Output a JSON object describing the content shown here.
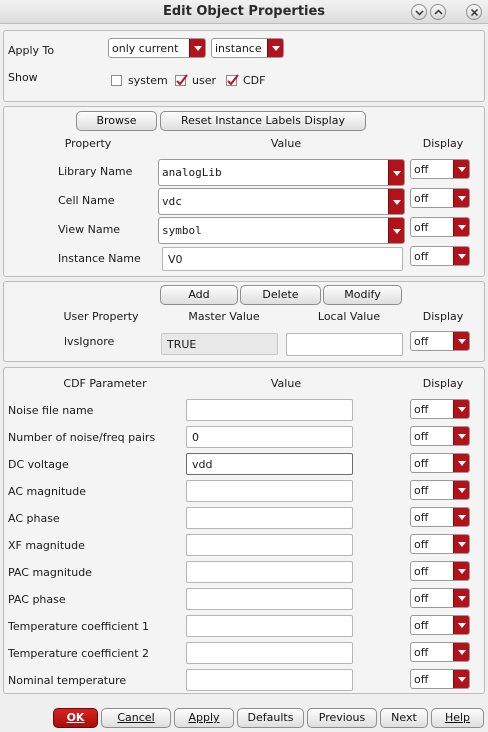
{
  "window": {
    "title": "Edit Object Properties"
  },
  "apply_to": {
    "label": "Apply To",
    "scope": "only current",
    "target": "instance"
  },
  "show": {
    "label": "Show",
    "system": {
      "label": "system",
      "checked": false
    },
    "user": {
      "label": "user",
      "checked": true
    },
    "cdf": {
      "label": "CDF",
      "checked": true
    }
  },
  "instance_section": {
    "browse_label": "Browse",
    "reset_label": "Reset Instance Labels Display",
    "headers": {
      "property": "Property",
      "value": "Value",
      "display": "Display"
    },
    "rows": [
      {
        "label": "Library Name",
        "value": "analogLib",
        "display": "off"
      },
      {
        "label": "Cell Name",
        "value": "vdc",
        "display": "off"
      },
      {
        "label": "View Name",
        "value": "symbol",
        "display": "off"
      },
      {
        "label": "Instance Name",
        "value": "V0",
        "display": "off"
      }
    ]
  },
  "user_section": {
    "add_label": "Add",
    "delete_label": "Delete",
    "modify_label": "Modify",
    "headers": {
      "user_property": "User Property",
      "master_value": "Master Value",
      "local_value": "Local Value",
      "display": "Display"
    },
    "rows": [
      {
        "label": "lvsIgnore",
        "master": "TRUE",
        "local": "",
        "display": "off"
      }
    ]
  },
  "cdf_section": {
    "headers": {
      "parameter": "CDF Parameter",
      "value": "Value",
      "display": "Display"
    },
    "rows": [
      {
        "label": "Noise file name",
        "value": "",
        "display": "off"
      },
      {
        "label": "Number of noise/freq pairs",
        "value": "0",
        "display": "off"
      },
      {
        "label": "DC voltage",
        "value": "vdd",
        "display": "off"
      },
      {
        "label": "AC magnitude",
        "value": "",
        "display": "off"
      },
      {
        "label": "AC phase",
        "value": "",
        "display": "off"
      },
      {
        "label": "XF magnitude",
        "value": "",
        "display": "off"
      },
      {
        "label": "PAC magnitude",
        "value": "",
        "display": "off"
      },
      {
        "label": "PAC phase",
        "value": "",
        "display": "off"
      },
      {
        "label": "Temperature coefficient 1",
        "value": "",
        "display": "off"
      },
      {
        "label": "Temperature coefficient 2",
        "value": "",
        "display": "off"
      },
      {
        "label": "Nominal temperature",
        "value": "",
        "display": "off"
      }
    ]
  },
  "footer": {
    "ok": "OK",
    "cancel": "Cancel",
    "apply": "Apply",
    "defaults": "Defaults",
    "previous": "Previous",
    "next": "Next",
    "help": "Help"
  },
  "colors": {
    "accent": "#b3121a",
    "ok_button": "#c41912"
  }
}
